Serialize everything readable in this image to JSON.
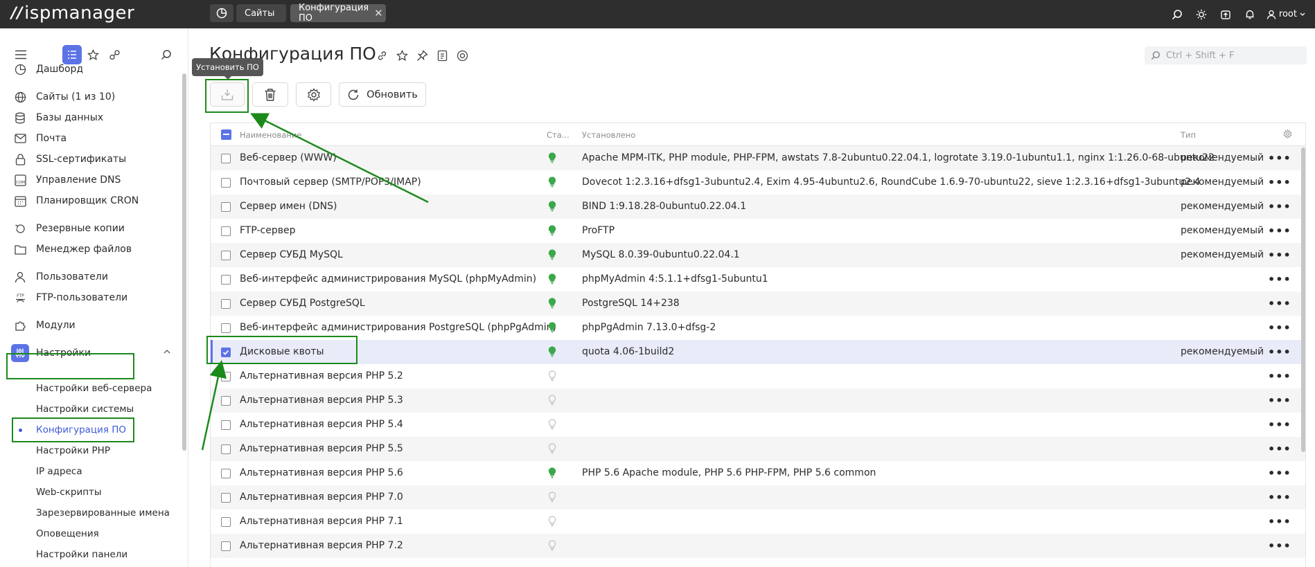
{
  "topbar": {
    "logo": "ispmanager",
    "tabs": [
      {
        "label": "Сайты"
      },
      {
        "label": "Конфигурация ПО"
      }
    ],
    "user": "root"
  },
  "sidebar": {
    "items": [
      {
        "label": "Дашборд"
      },
      {
        "label": "Сайты (1 из 10)"
      },
      {
        "label": "Базы данных"
      },
      {
        "label": "Почта"
      },
      {
        "label": "SSL-сертификаты"
      },
      {
        "label": "Управление DNS"
      },
      {
        "label": "Планировщик CRON"
      },
      {
        "label": "Резервные копии"
      },
      {
        "label": "Менеджер файлов"
      },
      {
        "label": "Пользователи"
      },
      {
        "label": "FTP-пользователи"
      },
      {
        "label": "Модули"
      },
      {
        "label": "Настройки"
      }
    ],
    "sub_items": [
      {
        "label": "Настройки веб-сервера"
      },
      {
        "label": "Настройки системы"
      },
      {
        "label": "Конфигурация ПО"
      },
      {
        "label": "Настройки PHP"
      },
      {
        "label": "IP адреса"
      },
      {
        "label": "Web-скрипты"
      },
      {
        "label": "Зарезервированные имена"
      },
      {
        "label": "Оповещения"
      },
      {
        "label": "Настройки панели"
      }
    ]
  },
  "page": {
    "title": "Конфигурация ПО",
    "search_placeholder": "Ctrl + Shift + F",
    "tooltip": "Установить ПО",
    "refresh_label": "Обновить"
  },
  "table": {
    "columns": {
      "name": "Наименование",
      "status": "Ста...",
      "installed": "Установлено",
      "type": "Тип"
    },
    "rows": [
      {
        "name": "Веб-сервер (WWW)",
        "status": "on",
        "installed": "Apache MPM-ITK, PHP module, PHP-FPM, awstats 7.8-2ubuntu0.22.04.1, logrotate 3.19.0-1ubuntu1.1, nginx 1:1.26.0-68-ubuntu22",
        "type": "рекомендуемый"
      },
      {
        "name": "Почтовый сервер (SMTP/POP3/IMAP)",
        "status": "on",
        "installed": "Dovecot 1:2.3.16+dfsg1-3ubuntu2.4, Exim 4.95-4ubuntu2.6, RoundCube 1.6.9-70-ubuntu22, sieve 1:2.3.16+dfsg1-3ubuntu2.4",
        "type": "рекомендуемый"
      },
      {
        "name": "Сервер имен (DNS)",
        "status": "on",
        "installed": "BIND 1:9.18.28-0ubuntu0.22.04.1",
        "type": "рекомендуемый"
      },
      {
        "name": "FTP-сервер",
        "status": "on",
        "installed": "ProFTP",
        "type": "рекомендуемый"
      },
      {
        "name": "Сервер СУБД MySQL",
        "status": "on",
        "installed": "MySQL 8.0.39-0ubuntu0.22.04.1",
        "type": "рекомендуемый"
      },
      {
        "name": "Веб-интерфейс администрирования MySQL (phpMyAdmin)",
        "status": "on",
        "installed": "phpMyAdmin 4:5.1.1+dfsg1-5ubuntu1",
        "type": ""
      },
      {
        "name": "Сервер СУБД PostgreSQL",
        "status": "on",
        "installed": "PostgreSQL 14+238",
        "type": ""
      },
      {
        "name": "Веб-интерфейс администрирования PostgreSQL (phpPgAdmin)",
        "status": "on",
        "installed": "phpPgAdmin 7.13.0+dfsg-2",
        "type": ""
      },
      {
        "name": "Дисковые квоты",
        "status": "on",
        "installed": "quota 4.06-1build2",
        "type": "рекомендуемый"
      },
      {
        "name": "Альтернативная версия PHP 5.2",
        "status": "off",
        "installed": "",
        "type": ""
      },
      {
        "name": "Альтернативная версия PHP 5.3",
        "status": "off",
        "installed": "",
        "type": ""
      },
      {
        "name": "Альтернативная версия PHP 5.4",
        "status": "off",
        "installed": "",
        "type": ""
      },
      {
        "name": "Альтернативная версия PHP 5.5",
        "status": "off",
        "installed": "",
        "type": ""
      },
      {
        "name": "Альтернативная версия PHP 5.6",
        "status": "on",
        "installed": "PHP 5.6 Apache module, PHP 5.6 PHP-FPM, PHP 5.6 common",
        "type": ""
      },
      {
        "name": "Альтернативная версия PHP 7.0",
        "status": "off",
        "installed": "",
        "type": ""
      },
      {
        "name": "Альтернативная версия PHP 7.1",
        "status": "off",
        "installed": "",
        "type": ""
      },
      {
        "name": "Альтернативная версия PHP 7.2",
        "status": "off",
        "installed": "",
        "type": ""
      }
    ]
  },
  "colors": {
    "accent": "#5c73e6",
    "status_on": "#3aa84b",
    "status_off": "#bdbdbd",
    "annotation": "#1b8a1b"
  }
}
